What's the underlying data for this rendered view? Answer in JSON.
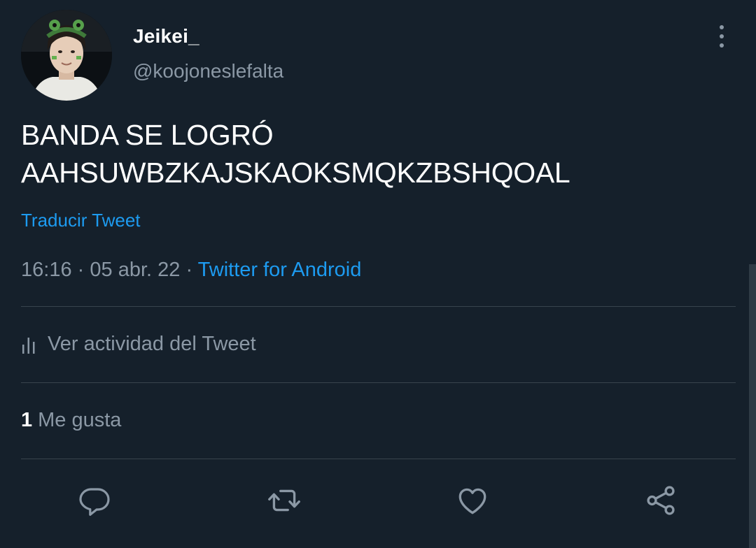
{
  "author": {
    "display_name": "Jeikei_",
    "handle": "@koojoneslefalta",
    "avatar_icon": "user-avatar-photo"
  },
  "tweet": {
    "text_lines": [
      "BANDA SE LOGRÓ",
      "AAHSUWBZKAJSKAOKSMQKZBSHQOAL"
    ],
    "translate_label": "Traducir Tweet",
    "time": "16:16",
    "separator": "·",
    "date": "05 abr. 22",
    "source": "Twitter for Android"
  },
  "activity": {
    "label": "Ver actividad del Tweet",
    "icon": "bar-chart-icon"
  },
  "likes": {
    "count": "1",
    "label": "Me gusta"
  },
  "actions": {
    "reply_icon": "reply-icon",
    "retweet_icon": "retweet-icon",
    "like_icon": "heart-icon",
    "share_icon": "share-icon",
    "more_icon": "more-vertical-icon"
  },
  "colors": {
    "background": "#15202b",
    "text_primary": "#ffffff",
    "text_secondary": "#8b98a5",
    "accent": "#1d9bf0",
    "divider": "#38444d"
  }
}
